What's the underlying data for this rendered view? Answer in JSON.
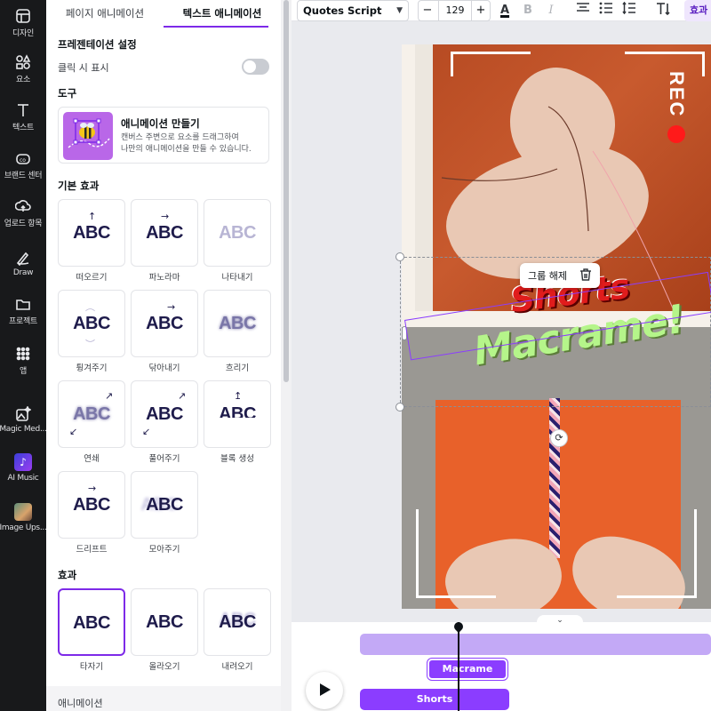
{
  "rail": {
    "items": [
      {
        "label": "디자인",
        "icon": "layout-icon"
      },
      {
        "label": "요소",
        "icon": "shapes-icon"
      },
      {
        "label": "텍스트",
        "icon": "text-icon"
      },
      {
        "label": "브랜드 센터",
        "icon": "brand-icon"
      },
      {
        "label": "업로드 항목",
        "icon": "upload-icon"
      },
      {
        "label": "Draw",
        "icon": "draw-icon"
      },
      {
        "label": "프로젝트",
        "icon": "folder-icon"
      },
      {
        "label": "앱",
        "icon": "apps-grid-icon"
      },
      {
        "label": "Magic Med...",
        "icon": "magic-media-icon"
      },
      {
        "label": "AI Music",
        "icon": "ai-music-icon"
      },
      {
        "label": "Image Ups...",
        "icon": "image-upscaler-icon"
      }
    ]
  },
  "panel": {
    "tabs": [
      "페이지 애니메이션",
      "텍스트 애니메이션"
    ],
    "active_tab": 1,
    "presentation_title": "프레젠테이션 설정",
    "show_on_click": "클릭 시 표시",
    "show_on_click_enabled": false,
    "tools_title": "도구",
    "tool": {
      "title": "애니메이션 만들기",
      "desc_line1": "캔버스 주변으로 요소를 드래그하여",
      "desc_line2": "나만의 애니메이션을 만들 수 있습니다."
    },
    "basic_title": "기본 효과",
    "basic_effects": [
      {
        "name": "떠오르기",
        "sample": "ABC"
      },
      {
        "name": "파노라마",
        "sample": "ABC"
      },
      {
        "name": "나타내기",
        "sample": "ABC"
      },
      {
        "name": "튕겨주기",
        "sample": "ABC"
      },
      {
        "name": "닦아내기",
        "sample": "ABC"
      },
      {
        "name": "흐리기",
        "sample": "ABC"
      },
      {
        "name": "연쇄",
        "sample": "ABC"
      },
      {
        "name": "풀어주기",
        "sample": "ABC"
      },
      {
        "name": "블록 생성",
        "sample": "ABC"
      },
      {
        "name": "드리프트",
        "sample": "ABC"
      },
      {
        "name": "모아주기",
        "sample": "ABC"
      }
    ],
    "effects_title": "효과",
    "effects": [
      {
        "name": "타자기",
        "sample": "ABC",
        "selected": true
      },
      {
        "name": "올라오기",
        "sample": "ABC",
        "selected": false
      },
      {
        "name": "내려오기",
        "sample": "ABC",
        "selected": false
      }
    ],
    "footer_title": "애니메이션"
  },
  "toolbar": {
    "font_name": "Quotes Script",
    "font_size": "129",
    "minus": "−",
    "plus": "+",
    "text_color_letter": "A",
    "text_color": "#0d1216",
    "bold": "B",
    "italic": "I",
    "effects_label": "효과"
  },
  "canvas": {
    "rec_label": "REC",
    "shorts_text": "Shorts",
    "macrame_text": "Macrame!",
    "context_menu_label": "그룹 해제"
  },
  "timeline": {
    "clip_macrame": "Macrame",
    "clip_shorts": "Shorts"
  },
  "colors": {
    "accent": "#7d2ae8",
    "rec_red": "#ff1a1a",
    "shorts_red": "#e01c1c",
    "macrame_green": "#b5f58a"
  }
}
